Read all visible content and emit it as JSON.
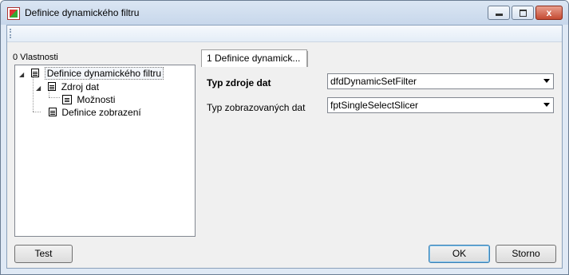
{
  "window": {
    "title": "Definice dynamického filtru",
    "close_glyph": "x"
  },
  "left_panel": {
    "label": "0 Vlastnosti",
    "tree": [
      {
        "label": "Definice dynamického filtru",
        "expanded": true,
        "selected": true
      },
      {
        "label": "Zdroj dat",
        "expanded": true
      },
      {
        "label": "Možnosti"
      },
      {
        "label": "Definice zobrazení"
      }
    ]
  },
  "tabs": [
    {
      "label": "1 Definice dynamick..."
    }
  ],
  "properties": [
    {
      "label": "Typ zdroje dat",
      "value": "dfdDynamicSetFilter",
      "bold": true
    },
    {
      "label": "Typ zobrazovaných dat",
      "value": "fptSingleSelectSlicer",
      "bold": false
    }
  ],
  "buttons": {
    "test": "Test",
    "ok": "OK",
    "cancel": "Storno"
  }
}
